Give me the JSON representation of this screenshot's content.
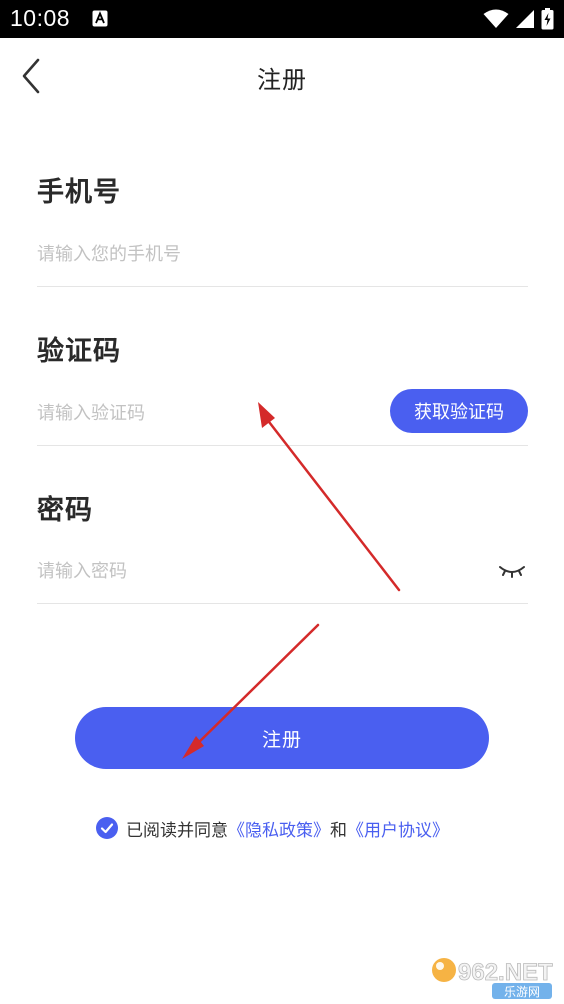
{
  "status_bar": {
    "time": "10:08"
  },
  "header": {
    "title": "注册"
  },
  "phone": {
    "label": "手机号",
    "placeholder": "请输入您的手机号"
  },
  "code": {
    "label": "验证码",
    "placeholder": "请输入验证码",
    "button_label": "获取验证码"
  },
  "password": {
    "label": "密码",
    "placeholder": "请输入密码"
  },
  "register_button": {
    "label": "注册"
  },
  "agreement": {
    "checked": true,
    "prefix": "已阅读并同意",
    "privacy_link": "《隐私政策》",
    "conjunction": "和",
    "user_agreement_link": "《用户协议》"
  },
  "watermark": {
    "brand": "962.NET",
    "subtitle": "乐游网"
  },
  "colors": {
    "accent": "#4a5ff0",
    "annotation_arrow": "#d42a2a"
  },
  "icons": {
    "back": "chevron-left-icon",
    "eye": "eye-closed-icon",
    "checkbox": "check-circle-icon",
    "wifi": "wifi-icon",
    "signal": "signal-icon",
    "battery": "battery-icon"
  }
}
